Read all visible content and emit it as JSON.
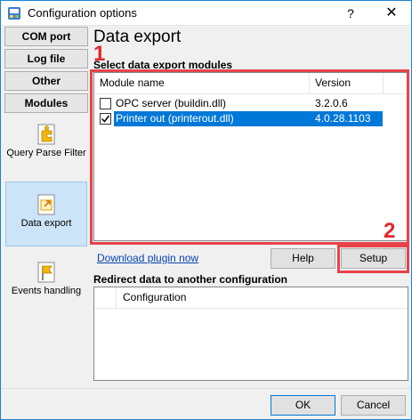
{
  "window": {
    "title": "Configuration options",
    "help_glyph": "?",
    "close_glyph": "✕"
  },
  "nav": {
    "buttons": [
      {
        "label": "COM port"
      },
      {
        "label": "Log file"
      },
      {
        "label": "Other"
      },
      {
        "label": "Modules"
      }
    ],
    "items": [
      {
        "label": "Query Parse Filter",
        "icon": "puzzle-icon"
      },
      {
        "label": "Data export",
        "icon": "export-icon",
        "selected": true
      },
      {
        "label": "Events handling",
        "icon": "flag-icon"
      }
    ]
  },
  "main": {
    "title": "Data export",
    "modules_label": "Select data export modules",
    "columns": [
      "Module name",
      "Version"
    ],
    "modules": [
      {
        "name": "OPC server (buildin.dll)",
        "version": "3.2.0.6",
        "checked": false,
        "selected": false
      },
      {
        "name": "Printer out (printerout.dll)",
        "version": "4.0.28.1103",
        "checked": true,
        "selected": true
      }
    ],
    "download_link": "Download plugin now",
    "help_button": "Help",
    "setup_button": "Setup",
    "redirect_label": "Redirect data to another configuration",
    "redirect_columns": [
      "Configuration"
    ]
  },
  "annotations": {
    "marker_1": "1",
    "marker_2": "2",
    "color": "#e3262c"
  },
  "footer": {
    "ok_button": "OK",
    "cancel_button": "Cancel"
  },
  "colors": {
    "accent": "#0078d7",
    "link": "#0645ad"
  }
}
